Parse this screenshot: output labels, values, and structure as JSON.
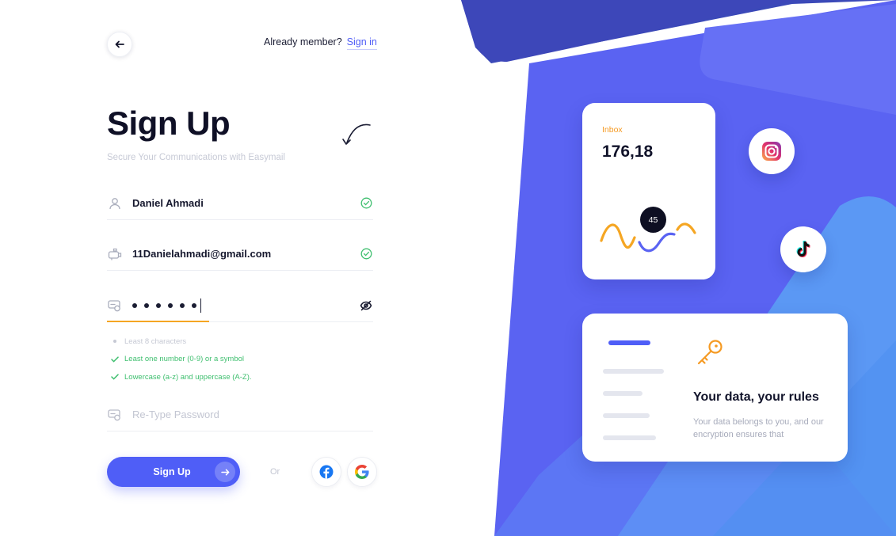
{
  "header": {
    "already_member": "Already member?",
    "signin_label": "Sign in"
  },
  "form": {
    "title": "Sign Up",
    "subtitle": "Secure Your Communications with Easymail",
    "name_value": "Daniel Ahmadi",
    "email_value": "11Danielahmadi@gmail.com",
    "password_dots": 6,
    "retype_placeholder": "Re-Type Password",
    "rules": [
      {
        "text": "Least 8 characters",
        "met": false
      },
      {
        "text": "Least one number (0-9) or a symbol",
        "met": true
      },
      {
        "text": "Lowercase (a-z) and uppercase (A-Z).",
        "met": true
      }
    ],
    "signup_label": "Sign Up",
    "or_label": "Or"
  },
  "inbox_card": {
    "label": "Inbox",
    "value": "176,18",
    "badge": "45"
  },
  "data_card": {
    "title": "Your data, your rules",
    "description": "Your data belongs to you, and our encryption ensures that"
  },
  "colors": {
    "accent": "#4f5ef7",
    "success": "#3fbf6f",
    "warning": "#f5a623",
    "art_blue_dark": "#3b49b8",
    "art_blue": "#5a63f2",
    "art_blue_light": "#5a9af5"
  },
  "icons": {
    "back": "arrow-left-icon",
    "name": "user-icon",
    "email": "mailbox-icon",
    "password": "password-icon",
    "valid": "check-circle-icon",
    "visibility": "eye-off-icon",
    "facebook": "facebook-icon",
    "google": "google-icon",
    "instagram": "instagram-icon",
    "tiktok": "tiktok-icon",
    "key": "key-icon"
  }
}
